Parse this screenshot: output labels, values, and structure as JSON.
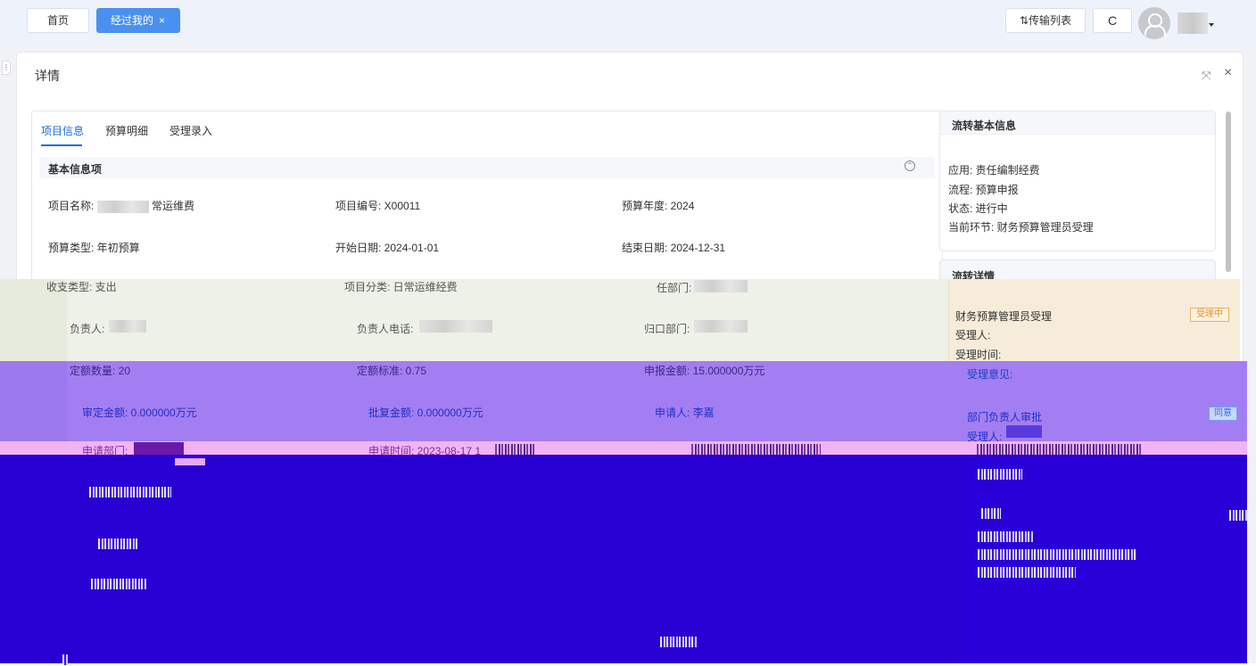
{
  "topbar": {
    "tabs": [
      {
        "label": "首页"
      },
      {
        "label": "经过我的",
        "close": "×"
      }
    ],
    "transfer_label": "⇅传输列表",
    "refresh_label": "C"
  },
  "dialog": {
    "title": "详情",
    "fullscreen_icon": "⤧",
    "close_icon": "×"
  },
  "left": {
    "tabs": [
      "项目信息",
      "预算明细",
      "受理录入"
    ],
    "section_title": "基本信息项",
    "fields": {
      "project_name_label": "项目名称:",
      "project_name_suffix": "常运维费",
      "project_no": "项目编号: X00011",
      "budget_year": "预算年度: 2024",
      "budget_type": "预算类型: 年初预算",
      "start_date": "开始日期: 2024-01-01",
      "end_date": "结束日期: 2024-12-31",
      "income_type": "收支类型: 支出",
      "project_category": "项目分类: 日常运维经费",
      "resp_dept": "任部门:",
      "owner": "负责人:",
      "owner_phone": "负责人电话:",
      "home_dept": "归口部门:",
      "quota_qty": "定额数量: 20",
      "quota_std": "定额标准: 0.75",
      "declared_amt": "申报金额: 15.000000万元",
      "approved_amt": "审定金额: 0.000000万元",
      "reply_amt": "批复金额: 0.000000万元",
      "applicant": "申请人: 李嘉",
      "apply_dept": "申请部门:",
      "apply_time": "申请时间: 2023-08-17 1"
    }
  },
  "right": {
    "basic_title": "流转基本信息",
    "app": "应用: 责任编制经费",
    "flow": "流程: 预算申报",
    "status": "状态: 进行中",
    "current": "当前环节: 财务预算管理员受理",
    "detail_title": "流转详情",
    "node1": {
      "title": "财务预算管理员受理",
      "badge": "受理中",
      "handler": "受理人:",
      "time": "受理时间:",
      "opinion": "受理意见:"
    },
    "node2": {
      "title": "部门负责人审批",
      "badge": "同意",
      "handler": "受理人:"
    }
  },
  "colors": {
    "primary": "#4a90f0",
    "tab_active": "#1e6be0",
    "glitch_purple": "#a37ef2",
    "glitch_blue": "#2a00d8",
    "glitch_pink": "#f2b3f5",
    "status_gold": "#e09a2a"
  }
}
